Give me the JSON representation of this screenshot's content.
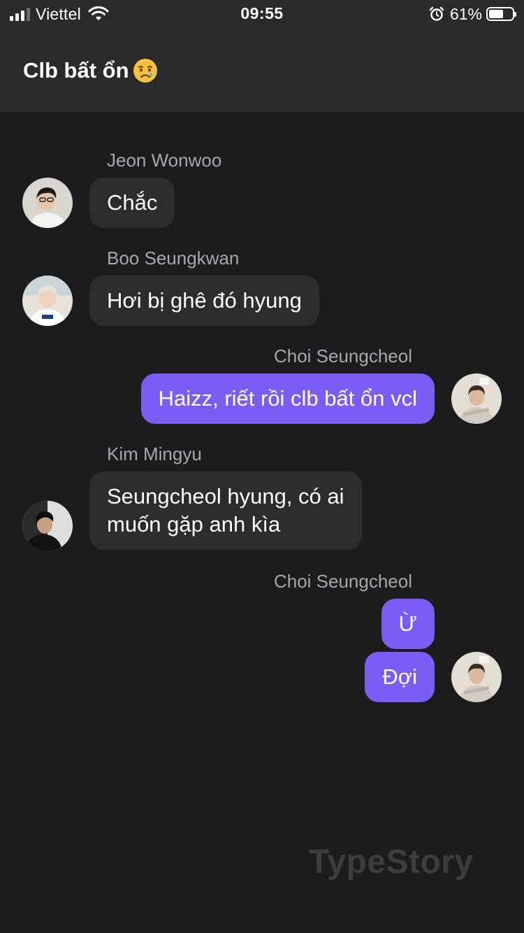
{
  "status_bar": {
    "carrier": "Viettel",
    "time": "09:55",
    "battery_percent": "61%",
    "battery_level": 0.61,
    "icons": [
      "cellular-signal-icon",
      "wifi-icon",
      "alarm-icon",
      "battery-icon"
    ]
  },
  "header": {
    "title": "Clb bất ổn",
    "emoji": "crying-face-emoji-icon"
  },
  "messages": [
    {
      "sender": "Jeon Wonwoo",
      "direction": "incoming",
      "texts": [
        "Chắc"
      ]
    },
    {
      "sender": "Boo Seungkwan",
      "direction": "incoming",
      "texts": [
        "Hơi bị ghê đó hyung"
      ]
    },
    {
      "sender": "Choi Seungcheol",
      "direction": "outgoing",
      "texts": [
        "Haizz, riết rồi clb bất ổn vcl"
      ]
    },
    {
      "sender": "Kim Mingyu",
      "direction": "incoming",
      "texts": [
        "Seungcheol hyung, có ai",
        "muốn gặp anh kìa"
      ]
    },
    {
      "sender": "Choi Seungcheol",
      "direction": "outgoing",
      "texts": [
        "Ừ",
        "Đợi"
      ]
    }
  ],
  "colors": {
    "background": "#1c1c1e",
    "header": "#2a2a2c",
    "incoming_bubble": "#2c2c2e",
    "outgoing_bubble": "#7b5cf5",
    "sender_name": "#a7a7ac"
  },
  "watermark": "TypeStory"
}
